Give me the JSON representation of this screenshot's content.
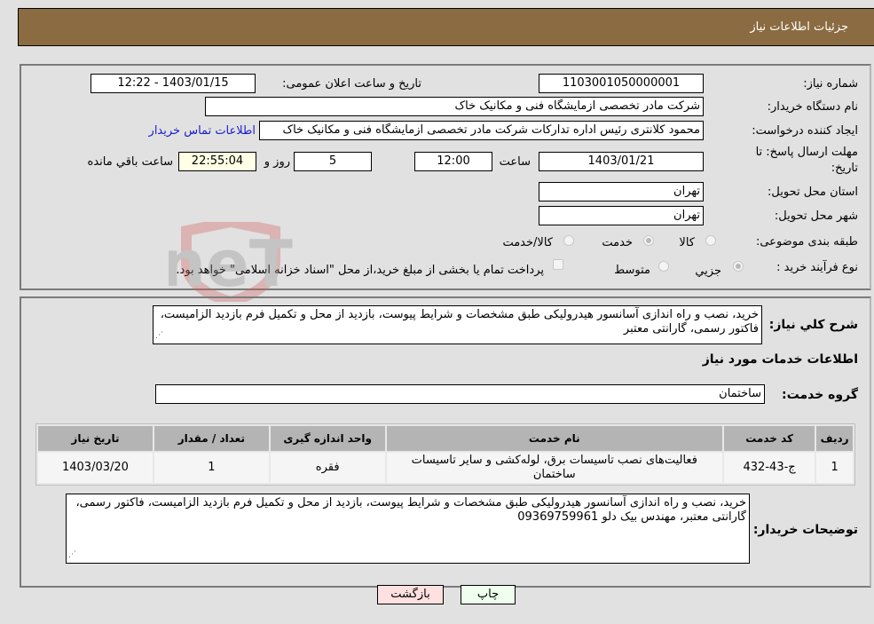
{
  "header": {
    "title": "جزئیات اطلاعات نیاز"
  },
  "form": {
    "need_number": {
      "label": "شماره نیاز:",
      "value": "1103001050000001"
    },
    "announce_datetime": {
      "label": "تاریخ و ساعت اعلان عمومی:",
      "value": "1403/01/15 - 12:22"
    },
    "buyer_org": {
      "label": "نام دستگاه خریدار:",
      "value": "شرکت مادر تخصصی ازمایشگاه فنی و مکانیک خاک"
    },
    "requester": {
      "label": "ایجاد کننده درخواست:",
      "value": "محمود کلانتری رئیس اداره تدارکات شرکت مادر تخصصی ازمایشگاه فنی و مکانیک خاک",
      "contact_link": "اطلاعات تماس خریدار"
    },
    "deadline": {
      "label_line1": "مهلت ارسال پاسخ: تا",
      "label_line2": "تاریخ:",
      "date": "1403/01/21",
      "time_label": "ساعت",
      "time": "12:00",
      "days": "5",
      "days_label": "روز و",
      "remaining": "22:55:04",
      "remaining_label": "ساعت باقي مانده"
    },
    "province": {
      "label": "استان محل تحویل:",
      "value": "تهران"
    },
    "city": {
      "label": "شهر محل تحویل:",
      "value": "تهران"
    },
    "category": {
      "label": "طبقه بندی موضوعی:",
      "options": [
        "کالا",
        "خدمت",
        "کالا/خدمت"
      ],
      "selected": "خدمت"
    },
    "purchase_type": {
      "label": "نوع فرآیند خرید :",
      "options": [
        "جزيي",
        "متوسط"
      ],
      "selected": "جزيي",
      "treasury_note": "پرداخت تمام یا بخشی از مبلغ خرید،از محل \"اسناد خزانه اسلامی\" خواهد بود."
    }
  },
  "details": {
    "description_label": "شرح كلي نياز:",
    "description": "خرید، نصب و راه اندازی آسانسور هیدرولیکی طبق مشخصات و شرایط پیوست، بازدید از محل و تکمیل فرم بازدید الزامیست، فاکتور رسمی، گارانتی معتبر",
    "services_heading": "اطلاعات خدمات مورد نياز",
    "service_group_label": "گروه خدمت:",
    "service_group": "ساختمان",
    "table": {
      "headers": [
        "رديف",
        "کد خدمت",
        "نام خدمت",
        "واحد اندازه گیری",
        "تعداد / مقدار",
        "تاریخ نیاز"
      ],
      "rows": [
        [
          "1",
          "ج-43-432",
          "فعالیت‌های نصب تاسیسات برق، لوله‌کشی و سایر تاسیسات ساختمان",
          "فقره",
          "1",
          "1403/03/20"
        ]
      ]
    },
    "buyer_notes_label": "توضیحات خریدار:",
    "buyer_notes": "خرید، نصب و راه اندازی آسانسور هیدرولیکی طبق مشخصات و شرایط پیوست، بازدید از محل و تکمیل فرم بازدید الزامیست، فاکتور رسمی، گارانتی معتبر، مهندس بیک دلو 09369759961"
  },
  "buttons": {
    "print": "چاپ",
    "back": "بازگشت"
  },
  "watermark": "AriaTender.neT"
}
